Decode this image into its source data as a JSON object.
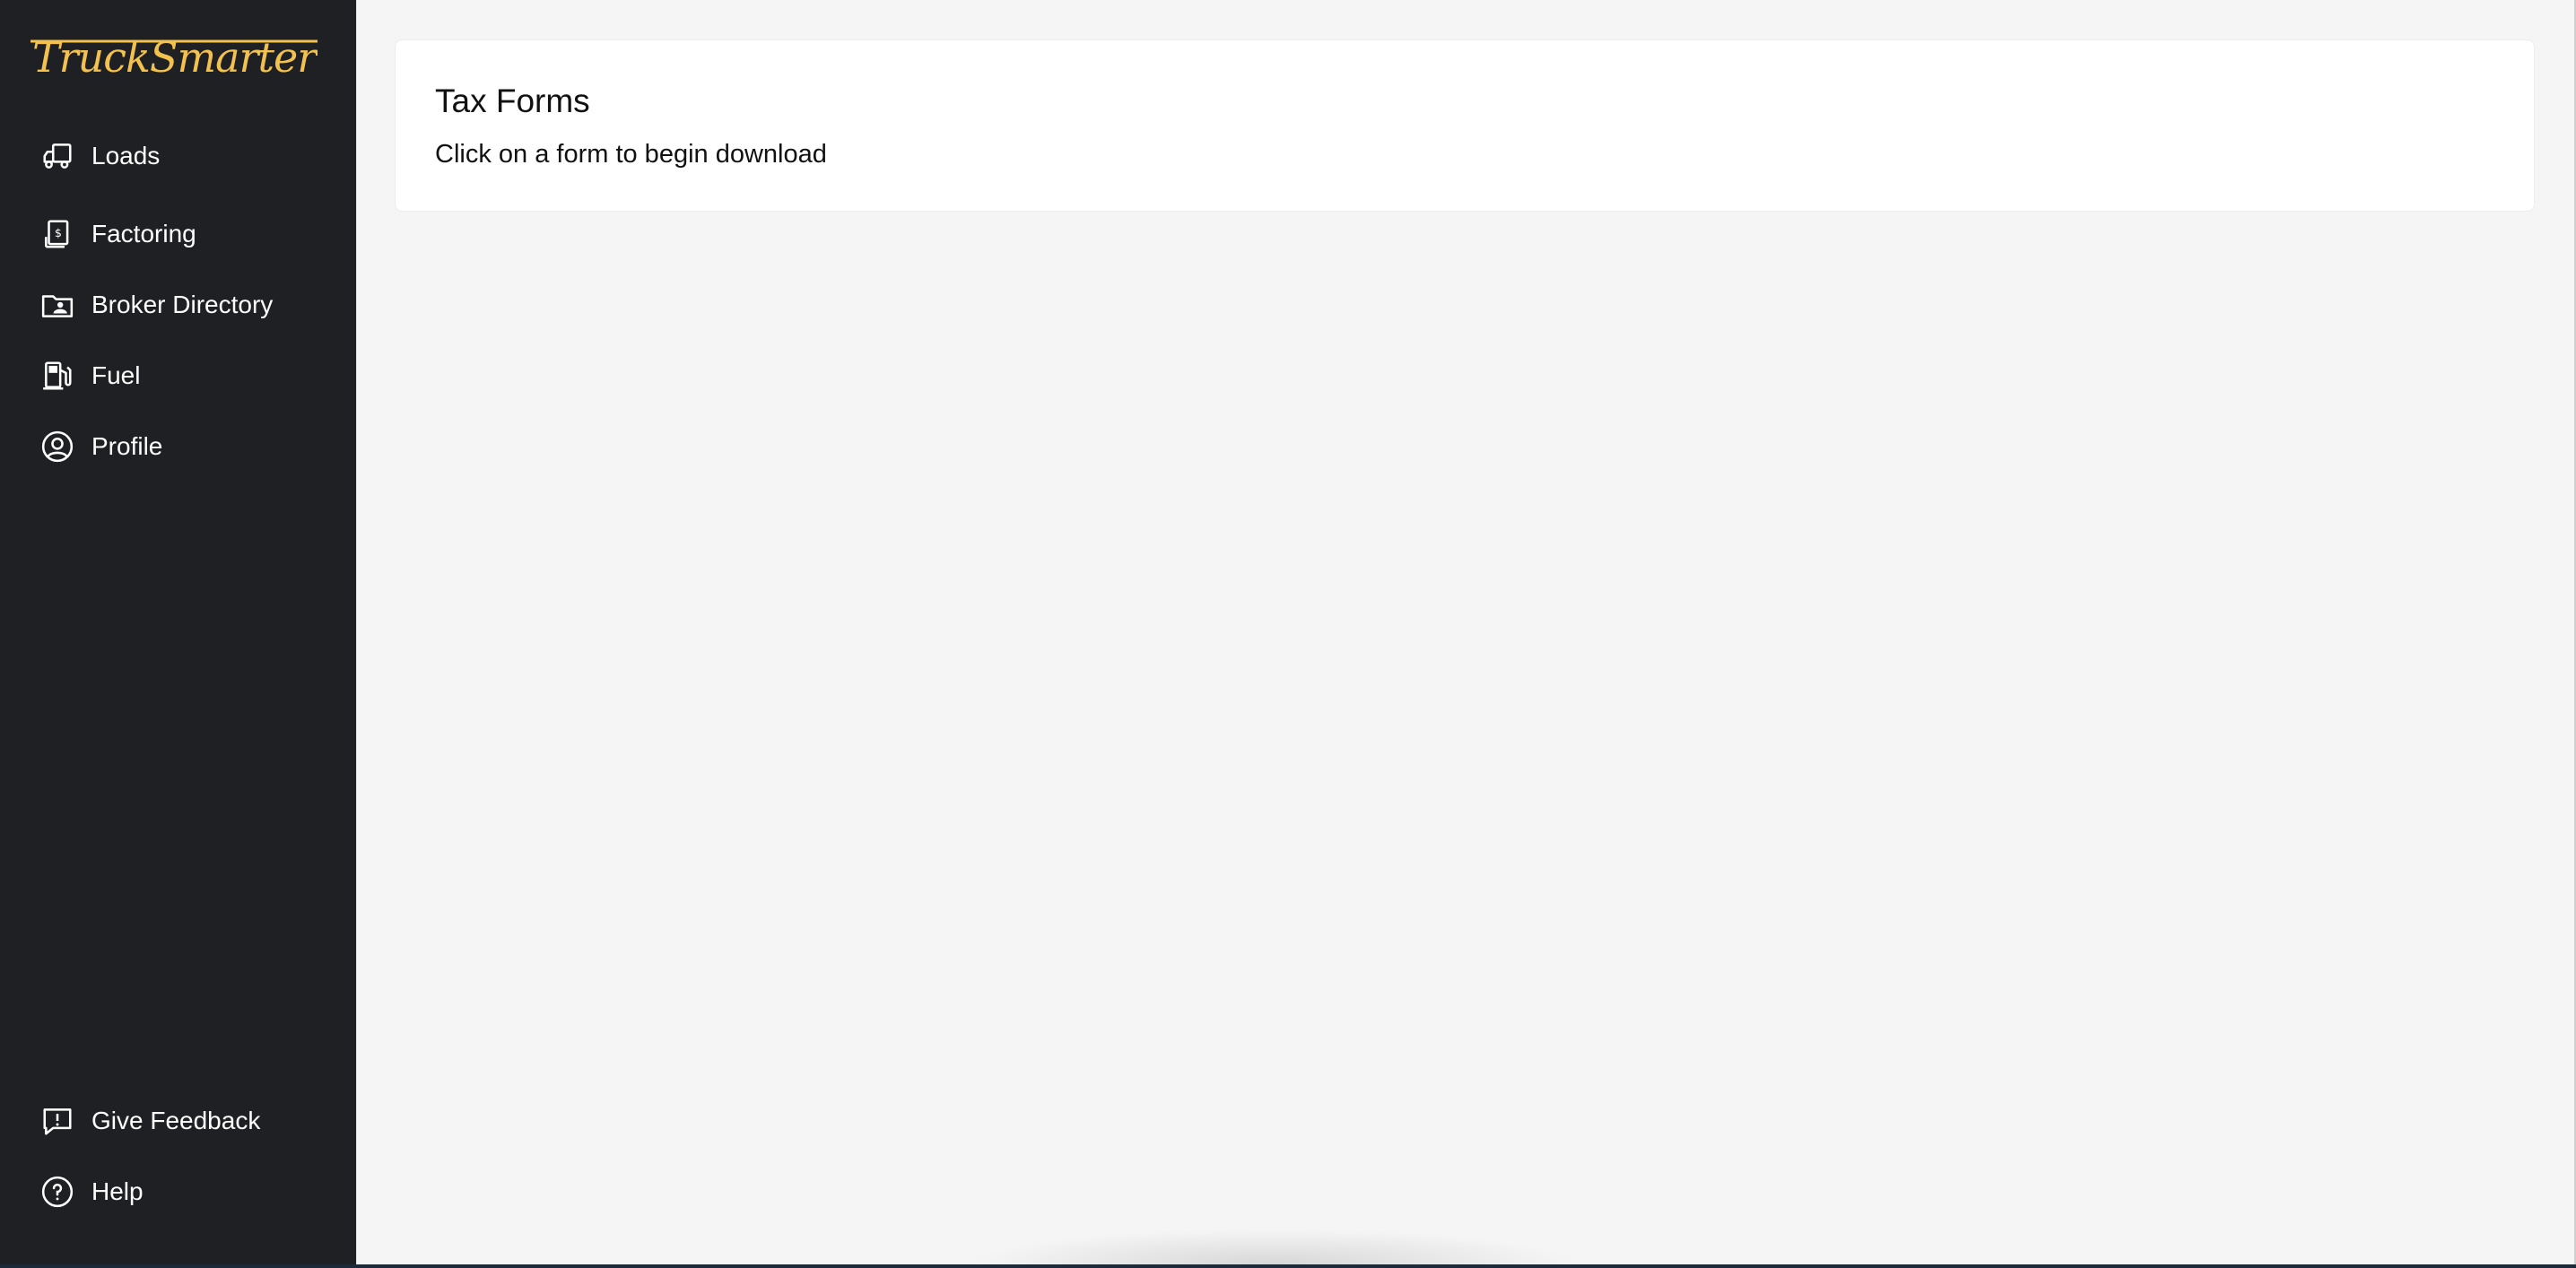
{
  "app": {
    "brand_name": "TruckSmarter",
    "brand_color": "#f2c14e",
    "sidebar_bg": "#1f2024"
  },
  "sidebar": {
    "items": [
      {
        "label": "Loads",
        "icon": "truck-icon"
      },
      {
        "label": "Factoring",
        "icon": "invoice-dollar-icon"
      },
      {
        "label": "Broker Directory",
        "icon": "folder-user-icon"
      },
      {
        "label": "Fuel",
        "icon": "fuel-pump-icon"
      },
      {
        "label": "Profile",
        "icon": "user-circle-icon"
      }
    ],
    "footer_items": [
      {
        "label": "Give Feedback",
        "icon": "feedback-icon"
      },
      {
        "label": "Help",
        "icon": "help-circle-icon"
      }
    ]
  },
  "main": {
    "card": {
      "title": "Tax Forms",
      "subtitle": "Click on a form to begin download"
    }
  }
}
